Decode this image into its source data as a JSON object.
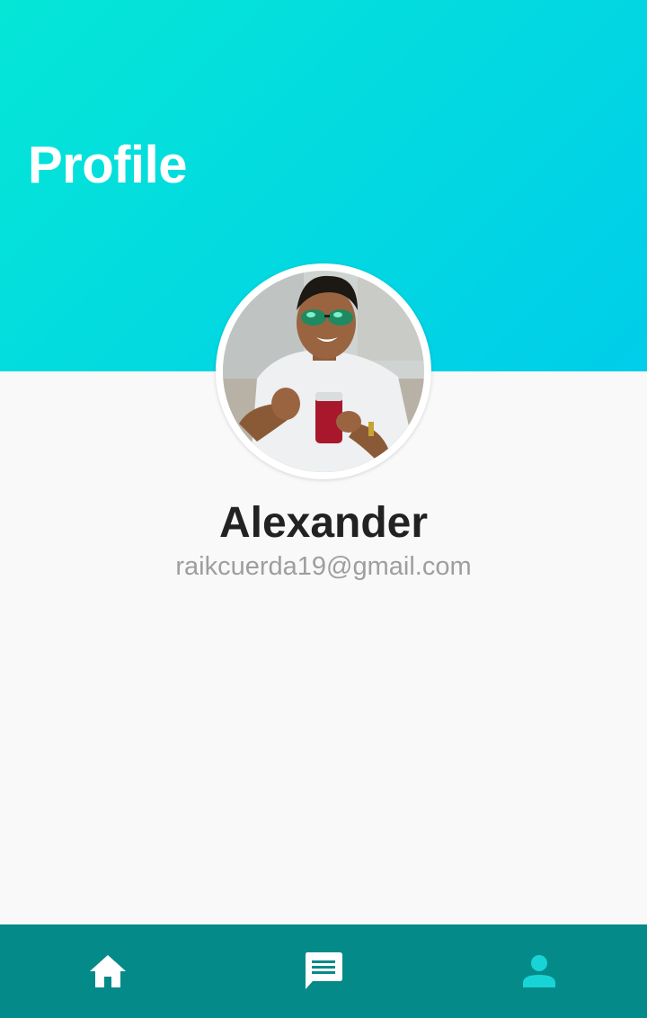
{
  "header": {
    "title": "Profile",
    "gradient_start": "#05e6d6",
    "gradient_end": "#00cdea"
  },
  "profile": {
    "avatar": "profile-photo",
    "name": "Alexander",
    "email": "raikcuerda19@gmail.com"
  },
  "bottom_nav": {
    "background": "#058a8a",
    "items": [
      {
        "icon": "home-icon",
        "color": "#ffffff"
      },
      {
        "icon": "chat-icon",
        "color": "#ffffff"
      },
      {
        "icon": "person-icon",
        "color": "#18d4d6",
        "active": true
      }
    ]
  }
}
